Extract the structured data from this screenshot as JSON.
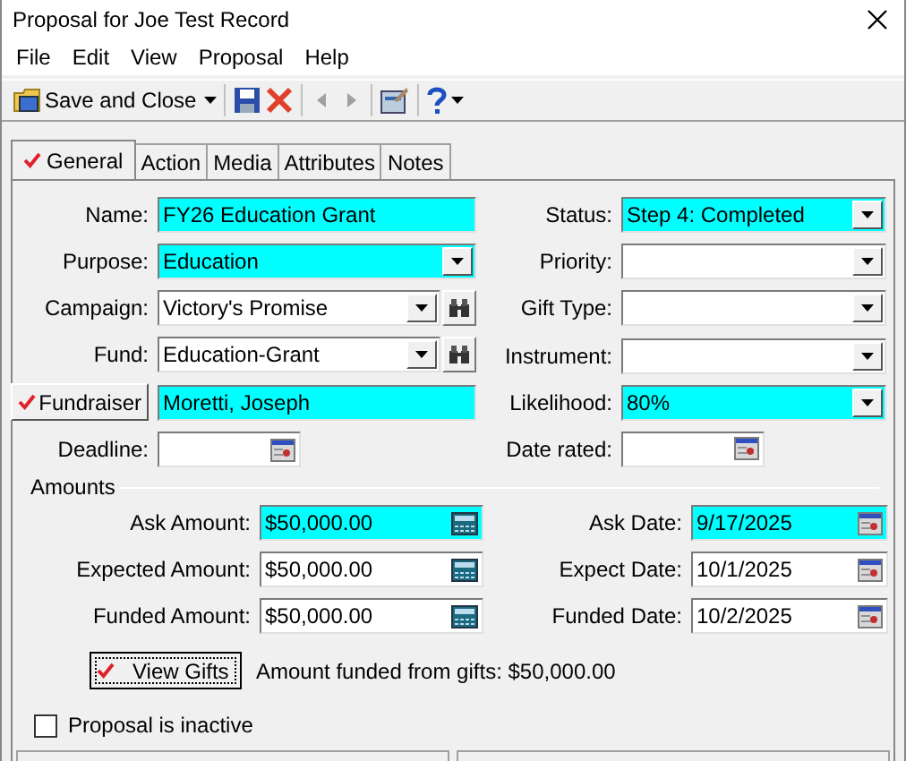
{
  "window": {
    "title": "Proposal for Joe Test Record"
  },
  "menu": [
    "File",
    "Edit",
    "View",
    "Proposal",
    "Help"
  ],
  "toolbar": {
    "save_close": "Save and Close"
  },
  "tabs": [
    {
      "label": "General",
      "selected": true,
      "checked": true
    },
    {
      "label": "Action",
      "selected": false,
      "checked": false
    },
    {
      "label": "Media",
      "selected": false,
      "checked": false
    },
    {
      "label": "Attributes",
      "selected": false,
      "checked": false
    },
    {
      "label": "Notes",
      "selected": false,
      "checked": false
    }
  ],
  "left_fields": [
    {
      "kind": "text",
      "label": "Name:",
      "value": "FY26 Education Grant",
      "highlighted": true
    },
    {
      "kind": "combo",
      "label": "Purpose:",
      "value": "Education",
      "highlighted": true
    },
    {
      "kind": "lookup",
      "label": "Campaign:",
      "value": "Victory's Promise",
      "highlighted": false
    },
    {
      "kind": "lookup",
      "label": "Fund:",
      "value": "Education-Grant",
      "highlighted": false
    },
    {
      "kind": "button",
      "label": "Fundraiser",
      "checked": true,
      "value": "Moretti, Joseph",
      "highlighted": true
    },
    {
      "kind": "date",
      "label": "Deadline:",
      "highlighted": false
    }
  ],
  "right_fields": [
    {
      "kind": "combo",
      "label": "Status:",
      "value": "Step 4: Completed",
      "highlighted": true
    },
    {
      "kind": "combo",
      "label": "Priority:",
      "highlighted": false
    },
    {
      "kind": "combo",
      "label": "Gift Type:",
      "highlighted": false
    },
    {
      "kind": "combo",
      "label": "Instrument:",
      "highlighted": false
    },
    {
      "kind": "combo",
      "label": "Likelihood:",
      "value": "80%",
      "highlighted": true
    },
    {
      "kind": "date",
      "label": "Date rated:",
      "highlighted": false
    }
  ],
  "amounts": {
    "title": "Amounts",
    "rows": [
      {
        "amount_label": "Ask Amount:",
        "amount": "$50,000.00",
        "amount_highlighted": true,
        "date_label": "Ask Date:",
        "date": "9/17/2025",
        "date_highlighted": true
      },
      {
        "amount_label": "Expected Amount:",
        "amount": "$50,000.00",
        "amount_highlighted": false,
        "date_label": "Expect Date:",
        "date": "10/1/2025",
        "date_highlighted": false
      },
      {
        "amount_label": "Funded Amount:",
        "amount": "$50,000.00",
        "amount_highlighted": false,
        "date_label": "Funded Date:",
        "date": "10/2/2025",
        "date_highlighted": false
      }
    ],
    "view_gifts": {
      "label": "View Gifts",
      "checked": true
    },
    "funded_note": "Amount funded from gifts: $50,000.00"
  },
  "inactive": {
    "label": "Proposal is inactive",
    "checked": false
  }
}
